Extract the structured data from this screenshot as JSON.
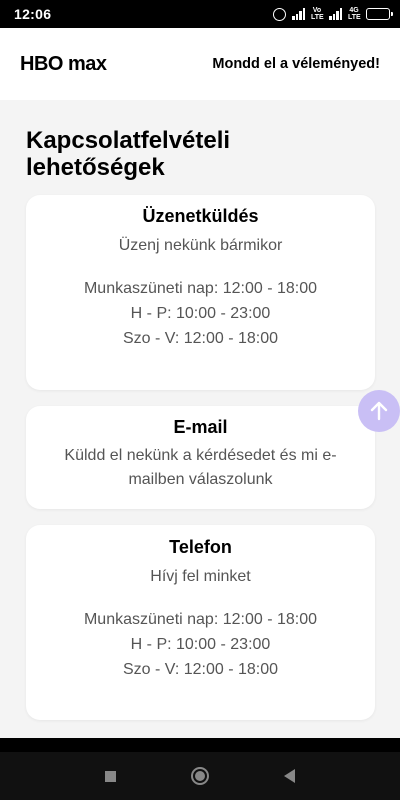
{
  "status_bar": {
    "time": "12:06",
    "net_label_1": "Vo LTE",
    "net_label_2": "4G LTE",
    "icons": [
      "alarm-icon",
      "signal-icon",
      "signal-icon",
      "battery-icon"
    ]
  },
  "header": {
    "logo": "HBO max",
    "feedback_link": "Mondd el a véleményed!"
  },
  "page": {
    "title": "Kapcsolatfelvételi lehetőségek"
  },
  "cards": {
    "messaging": {
      "title": "Üzenetküldés",
      "subtitle": "Üzenj nekünk bármikor",
      "hours": [
        "Munkaszüneti nap: 12:00 - 18:00",
        "H - P: 10:00 - 23:00",
        "Szo - V: 12:00 - 18:00"
      ]
    },
    "email": {
      "title": "E-mail",
      "subtitle": "Küldd el nekünk a kérdésedet és mi e-mailben válaszolunk"
    },
    "phone": {
      "title": "Telefon",
      "subtitle": "Hívj fel minket",
      "hours": [
        "Munkaszüneti nap: 12:00 - 18:00",
        "H - P: 10:00 - 23:00",
        "Szo - V: 12:00 - 18:00"
      ]
    }
  },
  "colors": {
    "scroll_top_button": "#c9bff5",
    "background": "#f4f4f4"
  },
  "nav": {
    "icons": [
      "recent-apps-icon",
      "home-icon",
      "back-icon"
    ]
  }
}
